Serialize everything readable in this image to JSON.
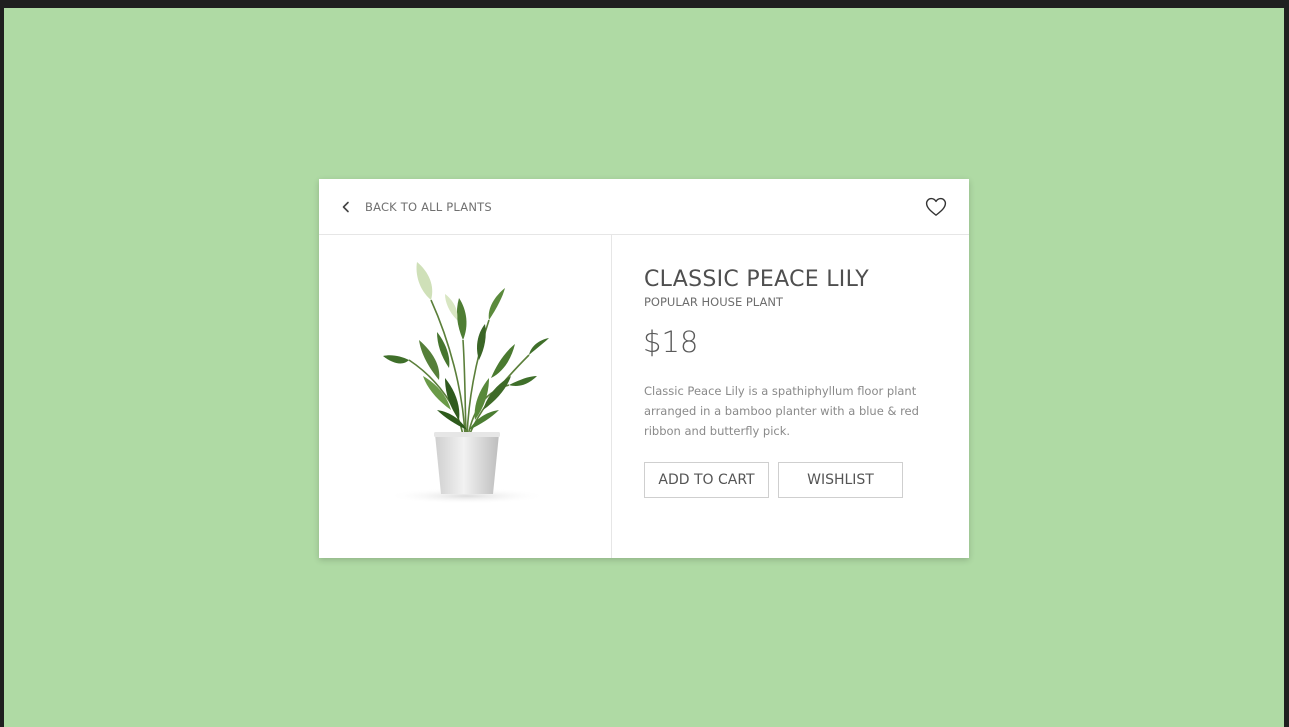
{
  "header": {
    "back_label": "BACK TO ALL PLANTS",
    "back_icon": "chevron-left-icon",
    "wishlist_icon": "heart-icon"
  },
  "product": {
    "image_alt": "plant-image",
    "title": "CLASSIC PEACE LILY",
    "subtitle": "POPULAR HOUSE PLANT",
    "price": "$18",
    "description": "Classic Peace Lily is a spathiphyllum floor plant arranged in a bamboo planter with a blue & red ribbon and butterfly pick."
  },
  "actions": {
    "add_to_cart": "ADD TO CART",
    "wishlist": "WISHLIST"
  },
  "colors": {
    "page_background": "#afdaa4",
    "card_background": "#ffffff",
    "frame": "#1f1f1f",
    "text_primary": "#4f4f4f",
    "text_muted": "#8a8a8a"
  }
}
